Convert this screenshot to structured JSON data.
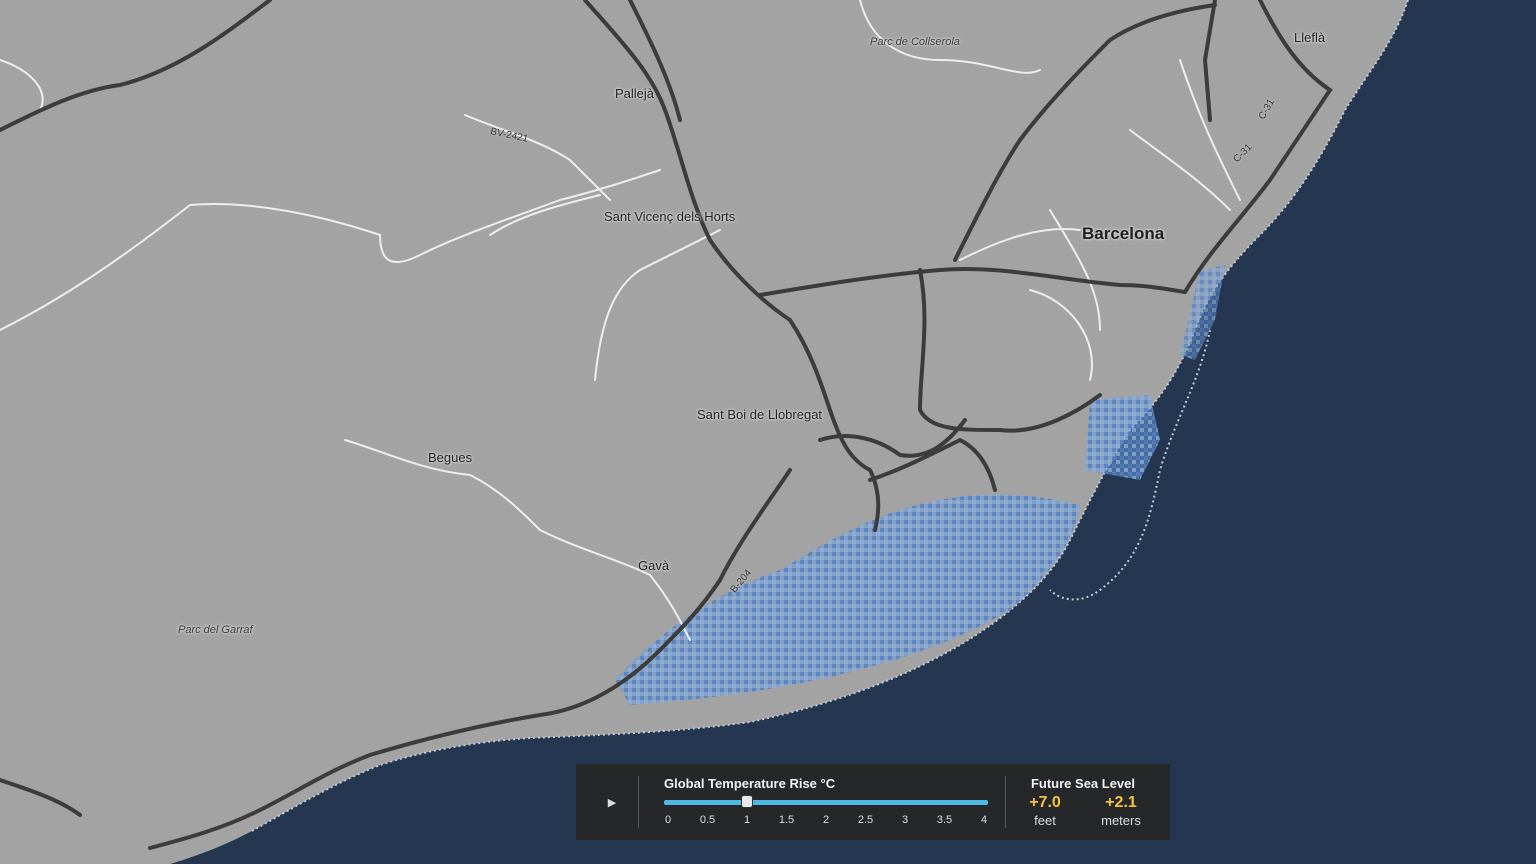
{
  "map": {
    "colors": {
      "land": "#a3a3a3",
      "water": "#243650",
      "flood": "#5b8fd0",
      "road_major": "#3c3c3c",
      "road_minor": "#ededed"
    },
    "places": [
      {
        "name": "Barcelona",
        "kind": "city"
      },
      {
        "name": "Pallejà",
        "kind": "town"
      },
      {
        "name": "Sant Vicenç dels Horts",
        "kind": "town"
      },
      {
        "name": "Sant Boi de Llobregat",
        "kind": "town"
      },
      {
        "name": "Begues",
        "kind": "town"
      },
      {
        "name": "Gavà",
        "kind": "town"
      },
      {
        "name": "Lleflà",
        "kind": "town"
      },
      {
        "name": "Parc de Collserola",
        "kind": "park"
      },
      {
        "name": "Parc del Garraf",
        "kind": "park"
      }
    ],
    "road_labels": [
      "BV-2421",
      "C-31",
      "C-31",
      "B-204"
    ]
  },
  "panel": {
    "play_icon": "play-icon",
    "slider_title": "Global Temperature Rise °C",
    "ticks": [
      "0",
      "0.5",
      "1",
      "1.5",
      "2",
      "2.5",
      "3",
      "3.5",
      "4"
    ],
    "slider_value": 1,
    "slider_min": 0,
    "slider_max": 4,
    "sea_title": "Future Sea Level",
    "feet_value": "+7.0",
    "feet_unit": "feet",
    "meters_value": "+2.1",
    "meters_unit": "meters"
  }
}
